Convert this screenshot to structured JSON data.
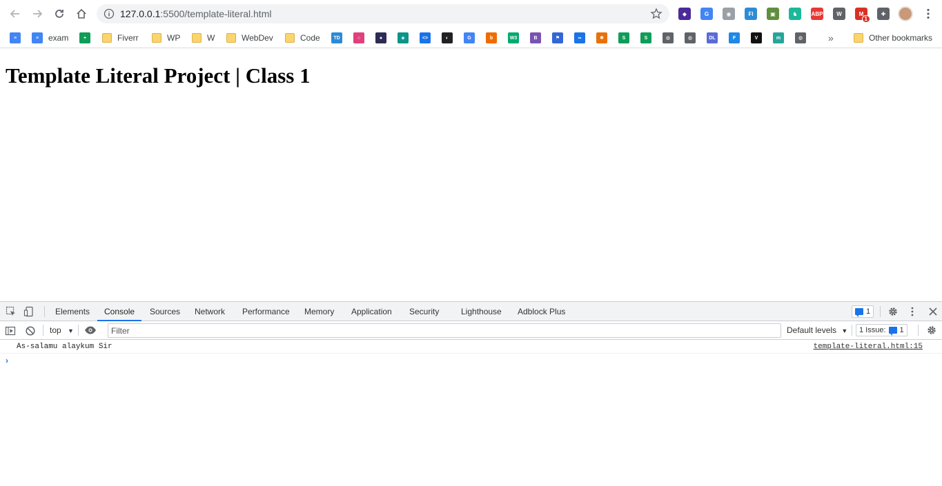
{
  "browser": {
    "url_host": "127.0.0.1",
    "url_path": ":5500/template-literal.html",
    "extensions": [
      {
        "name": "dark-diamond-ext",
        "color": "#4b2a9a",
        "glyph": "◆"
      },
      {
        "name": "google-translate-ext",
        "color": "#4285f4",
        "glyph": "G"
      },
      {
        "name": "camera-ext",
        "color": "#9aa0a6",
        "glyph": "◉"
      },
      {
        "name": "fi-ext",
        "color": "#2d8cd6",
        "glyph": "Fl"
      },
      {
        "name": "image-ext",
        "color": "#5f8f3e",
        "glyph": "▣"
      },
      {
        "name": "unicorn-ext",
        "color": "#1bb89a",
        "glyph": "♞"
      },
      {
        "name": "adblock-plus-ext",
        "color": "#e53935",
        "glyph": "ABP"
      },
      {
        "name": "wordpress-ext",
        "color": "#5f6368",
        "glyph": "W"
      },
      {
        "name": "gmail-ext",
        "color": "#d93025",
        "glyph": "M",
        "badge": "1"
      },
      {
        "name": "extensions-icon",
        "color": "#5f6368",
        "glyph": "✚"
      }
    ]
  },
  "bookmarks": [
    {
      "name": "docs",
      "label": "",
      "color": "#4285f4",
      "glyph": "≡"
    },
    {
      "name": "exam",
      "label": "exam",
      "color": "#4285f4",
      "glyph": "≡"
    },
    {
      "name": "sheets",
      "label": "",
      "color": "#0f9d58",
      "glyph": "+"
    },
    {
      "name": "fiverr",
      "label": "Fiverr",
      "folder": true
    },
    {
      "name": "wp",
      "label": "WP",
      "folder": true
    },
    {
      "name": "w",
      "label": "W",
      "folder": true
    },
    {
      "name": "webdev",
      "label": "WebDev",
      "folder": true
    },
    {
      "name": "code",
      "label": "Code",
      "folder": true
    }
  ],
  "bookmark_icons": [
    {
      "name": "td",
      "color": "#2b8ad8",
      "glyph": "TD"
    },
    {
      "name": "ring",
      "color": "#e0407b",
      "glyph": "○"
    },
    {
      "name": "dark-circle",
      "color": "#2c2c54",
      "glyph": "●"
    },
    {
      "name": "cube",
      "color": "#0d9488",
      "glyph": "◈"
    },
    {
      "name": "code-brackets",
      "color": "#1a73e8",
      "glyph": "<>"
    },
    {
      "name": "github",
      "color": "#202124",
      "glyph": "◐"
    },
    {
      "name": "translate",
      "color": "#4285f4",
      "glyph": "G"
    },
    {
      "name": "blogger",
      "color": "#ef6c00",
      "glyph": "b"
    },
    {
      "name": "w3schools",
      "color": "#04aa6d",
      "glyph": "W3"
    },
    {
      "name": "bootstrap",
      "color": "#7952b3",
      "glyph": "B"
    },
    {
      "name": "flag",
      "color": "#3367d6",
      "glyph": "⚑"
    },
    {
      "name": "infinity",
      "color": "#1a73e8",
      "glyph": "∞"
    },
    {
      "name": "puzzle",
      "color": "#e8710a",
      "glyph": "✱"
    },
    {
      "name": "s-green",
      "color": "#0f9d58",
      "glyph": "S"
    },
    {
      "name": "s-green-2",
      "color": "#0f9d58",
      "glyph": "S"
    },
    {
      "name": "globe",
      "color": "#5f6368",
      "glyph": "◍"
    },
    {
      "name": "globe-2",
      "color": "#5f6368",
      "glyph": "◍"
    },
    {
      "name": "dl",
      "color": "#5b6bd6",
      "glyph": "DL"
    },
    {
      "name": "f-blue",
      "color": "#1e88e5",
      "glyph": "F"
    },
    {
      "name": "v-black",
      "color": "#111111",
      "glyph": "V"
    },
    {
      "name": "m-teal",
      "color": "#26a69a",
      "glyph": "m"
    },
    {
      "name": "globe-3",
      "color": "#5f6368",
      "glyph": "◍"
    }
  ],
  "other_bookmarks": "Other bookmarks",
  "more_bookmarks": "»",
  "page": {
    "heading": "Template Literal Project | Class 1"
  },
  "devtools": {
    "tabs": [
      "Elements",
      "Console",
      "Sources",
      "Network",
      "Performance",
      "Memory",
      "Application",
      "Security",
      "Lighthouse",
      "Adblock Plus"
    ],
    "active_tab": "Console",
    "issues_badge": "1",
    "context": "top",
    "filter_placeholder": "Filter",
    "levels": "Default levels",
    "issues_text": "1 Issue:",
    "issues_count": "1",
    "log_message": "As-salamu alaykum Sir",
    "log_source": "template-literal.html:15"
  },
  "colors": {
    "accent": "#1a73e8",
    "devtools_bg": "#f1f3f4"
  }
}
